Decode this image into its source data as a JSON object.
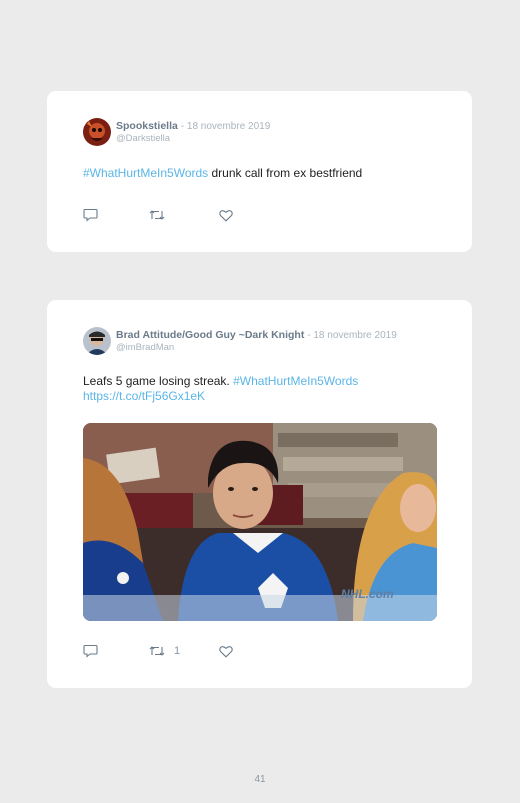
{
  "tweets": [
    {
      "name": "Spookstiella",
      "date": "- 18 novembre 2019",
      "handle": "@Darkstiella",
      "hashtag": "#WhatHurtMeIn5Words",
      "text": " drunk call from ex bestfriend",
      "retweet_count": ""
    },
    {
      "name": "Brad Attitude/Good Guy ~Dark Knight",
      "date": "- 18 novembre 2019",
      "handle": "@imBradMan",
      "text": "Leafs 5 game losing streak. ",
      "hashtag": "#WhatHurtMeIn5Words",
      "link": "https://t.co/tFj56Gx1eK",
      "retweet_count": "1"
    }
  ],
  "media_watermark": "NHL.com",
  "page_number": "41",
  "colors": {
    "hashtag": "#5ab5e6",
    "name": "#6b7b8a",
    "meta": "#a9b4bd",
    "background": "#ebebeb"
  },
  "icons": [
    "reply-icon",
    "retweet-icon",
    "like-icon"
  ]
}
